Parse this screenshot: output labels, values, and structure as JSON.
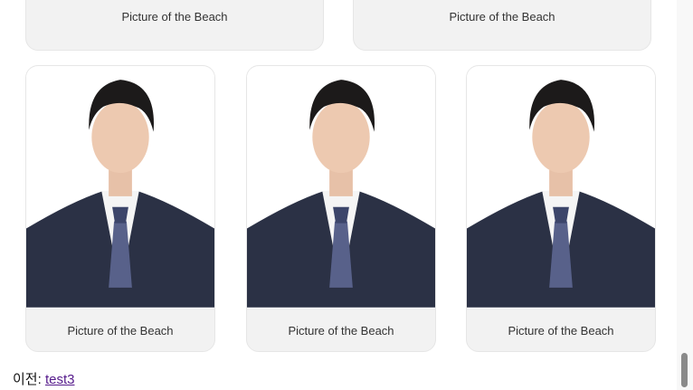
{
  "gallery": {
    "top_row": [
      {
        "caption": "Picture of the Beach"
      },
      {
        "caption": "Picture of the Beach"
      }
    ],
    "bottom_row": [
      {
        "caption": "Picture of the Beach"
      },
      {
        "caption": "Picture of the Beach"
      },
      {
        "caption": "Picture of the Beach"
      }
    ]
  },
  "prev_nav": {
    "label": "이전:",
    "link_text": "test3"
  },
  "colors": {
    "card_bg": "#f2f2f2",
    "suit": "#2b3145",
    "link": "#551a8b"
  }
}
